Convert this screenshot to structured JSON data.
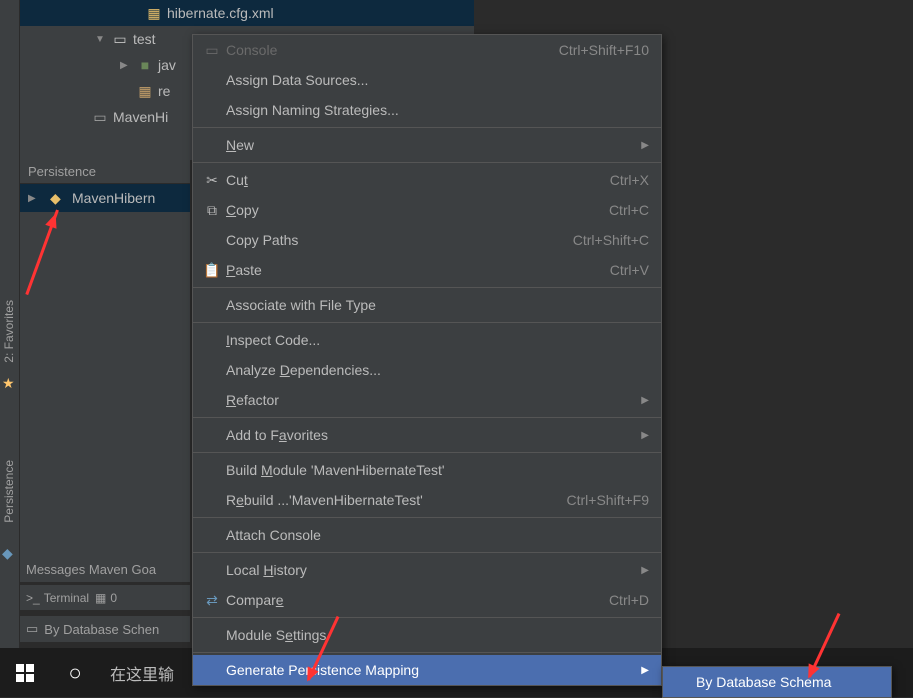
{
  "tree": {
    "hibernate_cfg": "hibernate.cfg.xml",
    "test": "test",
    "java_partial": "jav",
    "resources_partial": "re",
    "module": "MavenHi"
  },
  "persistence": {
    "title": "Persistence",
    "project_partial": "MavenHibern"
  },
  "bottom": {
    "messages": "Messages Maven Goa",
    "terminal": "Terminal",
    "file_short": "0",
    "status": "By Database Schen"
  },
  "taskbar": {
    "search_hint": "在这里输"
  },
  "menu": {
    "console": {
      "label": "Console",
      "shortcut": "Ctrl+Shift+F10"
    },
    "assign_ds": {
      "label": "Assign Data Sources..."
    },
    "assign_naming": {
      "label": "Assign Naming Strategies..."
    },
    "new": {
      "label": "New",
      "u": "N"
    },
    "cut": {
      "label": "Cut",
      "u": "t",
      "prefix": "Cu",
      "shortcut": "Ctrl+X"
    },
    "copy": {
      "label": "Copy",
      "u": "C",
      "suffix": "opy",
      "shortcut": "Ctrl+C"
    },
    "copy_paths": {
      "label": "Copy Paths",
      "shortcut": "Ctrl+Shift+C"
    },
    "paste": {
      "label": "Paste",
      "u": "P",
      "suffix": "aste",
      "shortcut": "Ctrl+V"
    },
    "associate": {
      "label": "Associate with File Type"
    },
    "inspect": {
      "label": "Inspect Code...",
      "u": "I",
      "suffix": "nspect Code..."
    },
    "analyze": {
      "label": "Analyze Dependencies...",
      "prefix": "Analyze ",
      "u": "D",
      "suffix": "ependencies..."
    },
    "refactor": {
      "label": "Refactor",
      "u": "R",
      "suffix": "efactor"
    },
    "favorites": {
      "label": "Add to Favorites",
      "prefix": "Add to F",
      "u": "a",
      "suffix": "vorites"
    },
    "build": {
      "label": "Build Module 'MavenHibernateTest'",
      "prefix": "Build ",
      "u": "M",
      "suffix": "odule 'MavenHibernateTest'"
    },
    "rebuild": {
      "label": "Rebuild ...'MavenHibernateTest'",
      "prefix": "R",
      "u": "e",
      "suffix": "build ...'MavenHibernateTest'",
      "shortcut": "Ctrl+Shift+F9"
    },
    "attach": {
      "label": "Attach Console"
    },
    "local_history": {
      "label": "Local History",
      "prefix": "Local ",
      "u": "H",
      "suffix": "istory"
    },
    "compare": {
      "label": "Compare",
      "prefix": "Compar",
      "u": "e",
      "shortcut": "Ctrl+D"
    },
    "module_settings": {
      "label": "Module Settings",
      "prefix": "Module S",
      "u": "e",
      "suffix": "ttings"
    },
    "generate": {
      "label": "Generate Persistence Mapping"
    }
  },
  "submenu": {
    "by_db": "By Database Schema"
  },
  "sidebar": {
    "favorites": "2: Favorites",
    "persistence": "Persistence"
  }
}
